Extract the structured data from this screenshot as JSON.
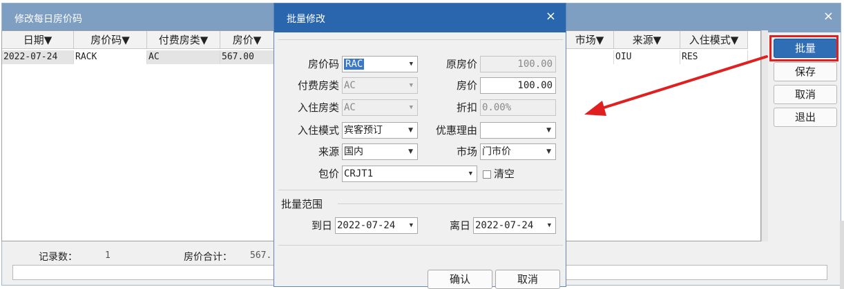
{
  "background_window": {
    "title": "修改每日房价码",
    "close_glyph": "×",
    "grid": {
      "columns": [
        "日期▼",
        "房价码▼",
        "付费房类▼",
        "房价▼",
        "市场▼",
        "来源▼",
        "入住模式▼"
      ],
      "rows": [
        {
          "date": "2022-07-24",
          "rate_code": "RACK",
          "room_type": "AC",
          "price": "567.00",
          "market": "",
          "source": "OIU",
          "checkin_mode": "RES"
        }
      ]
    },
    "footer": {
      "record_count_label": "记录数：",
      "record_count": "1",
      "price_total_label": "房价合计：",
      "price_total": "567."
    },
    "side_buttons": {
      "batch": "批量",
      "save": "保存",
      "cancel": "取消",
      "exit": "退出"
    },
    "highlight_color": "#e02020"
  },
  "modal": {
    "title": "批量修改",
    "close_glyph": "×",
    "fields": {
      "rate_code": {
        "label": "房价码",
        "value": "RAC"
      },
      "paid_room_type": {
        "label": "付费房类",
        "value": "AC"
      },
      "checkin_room_type": {
        "label": "入住房类",
        "value": "AC"
      },
      "checkin_mode": {
        "label": "入住模式",
        "value": "宾客预订"
      },
      "source": {
        "label": "来源",
        "value": "国内"
      },
      "package": {
        "label": "包价",
        "value": "CRJT1"
      },
      "original_price": {
        "label": "原房价",
        "value": "100.00"
      },
      "price": {
        "label": "房价",
        "value": "100.00"
      },
      "discount": {
        "label": "折扣",
        "value": "0.00%"
      },
      "discount_reason": {
        "label": "优惠理由",
        "value": ""
      },
      "market": {
        "label": "市场",
        "value": "门市价"
      },
      "clear": {
        "label": "清空"
      }
    },
    "batch_range": {
      "title": "批量范围",
      "to_label": "到日",
      "to_value": "2022-07-24",
      "leave_label": "离日",
      "leave_value": "2022-07-24"
    },
    "buttons": {
      "confirm": "确认",
      "cancel": "取消"
    },
    "accent_color": "#2966ad"
  },
  "icons": {
    "dropdown": "chevron-down-icon",
    "close": "close-icon",
    "annotation": "red-arrow-annotation"
  }
}
